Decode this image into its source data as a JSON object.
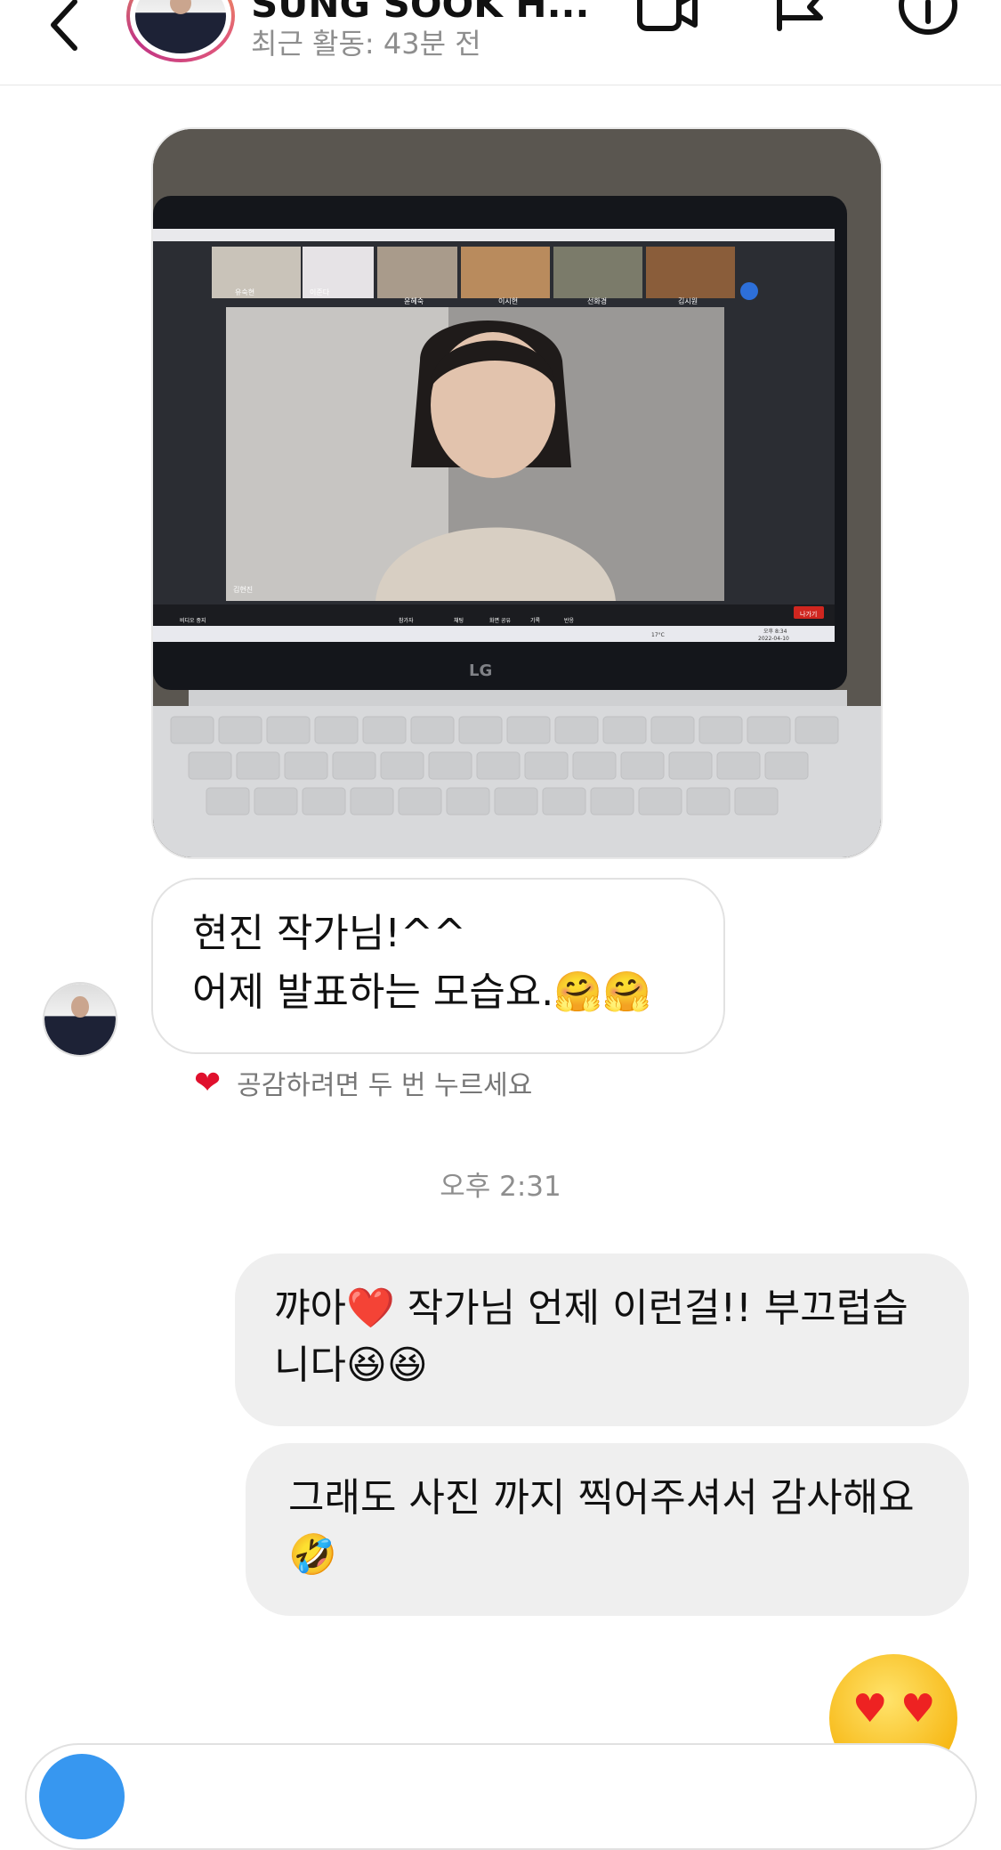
{
  "header": {
    "title": "SUNG SOOK H...",
    "subtitle": "최근 활동: 43분 전"
  },
  "photo": {
    "description_icon": "laptop-video-call-photo",
    "laptop_brand": "LG",
    "participants": [
      "유숙현",
      "이준다",
      "윤혜숙",
      "이시현",
      "선화경",
      "김시원"
    ],
    "main_speaker_label": "김현진",
    "toolbar": [
      "비디오 중지",
      "참가자",
      "채팅",
      "화면 공유",
      "기록",
      "반응"
    ],
    "leave_label": "나가기",
    "taskbar_temp": "17°C",
    "taskbar_time": "오후 8:34",
    "taskbar_date": "2022-04-10"
  },
  "incoming": {
    "line1": "현진 작가님!^^",
    "line2": "어제 발표하는 모습요.🤗🤗",
    "hint": "공감하려면 두 번 누르세요"
  },
  "timestamp": "오후 2:31",
  "outgoing": [
    {
      "line1": "꺄아❤️ 작가님 언제 이런걸!! 부끄럽습",
      "line2": "니다😆😆"
    },
    {
      "line1": "그래도 사진 까지 찍어주셔서 감사해요",
      "line2": "🤣"
    }
  ],
  "reaction_emoji": "😍",
  "colors": {
    "accent": "#3797f0",
    "bubble_out": "#efefef",
    "heart": "#e0102d"
  }
}
